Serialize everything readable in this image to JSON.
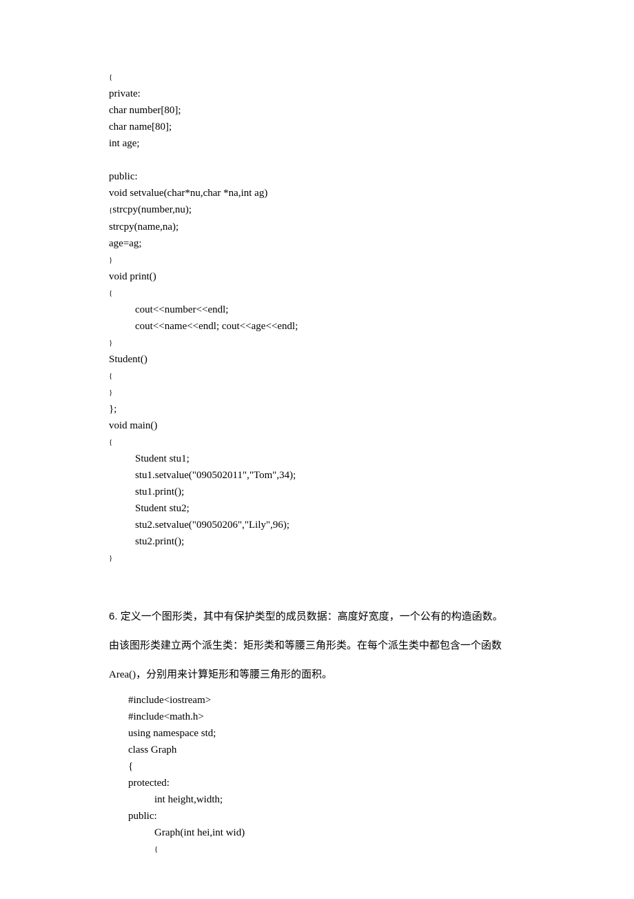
{
  "code1": {
    "lines": [
      {
        "text": "{",
        "cls": "small"
      },
      {
        "text": "private:",
        "cls": ""
      },
      {
        "text": "char number[80];",
        "cls": ""
      },
      {
        "text": "char name[80];",
        "cls": ""
      },
      {
        "text": "int age;",
        "cls": ""
      },
      {
        "text": "",
        "cls": ""
      },
      {
        "text": "public:",
        "cls": ""
      },
      {
        "text": "void setvalue(char*nu,char *na,int ag)",
        "cls": ""
      },
      {
        "text": "{strcpy(number,nu);",
        "cls": "mixed-open"
      },
      {
        "text": "strcpy(name,na);",
        "cls": ""
      },
      {
        "text": "age=ag;",
        "cls": ""
      },
      {
        "text": "}",
        "cls": "small"
      },
      {
        "text": "void print()",
        "cls": ""
      },
      {
        "text": "{",
        "cls": "small"
      },
      {
        "text": "cout<<number<<endl;",
        "cls": "indent1"
      },
      {
        "text": "cout<<name<<endl; cout<<age<<endl;",
        "cls": "indent1"
      },
      {
        "text": "}",
        "cls": "small"
      },
      {
        "text": "Student()",
        "cls": ""
      },
      {
        "text": "{",
        "cls": "small"
      },
      {
        "text": "}",
        "cls": "small"
      },
      {
        "text": "};",
        "cls": ""
      },
      {
        "text": "void main()",
        "cls": ""
      },
      {
        "text": "{",
        "cls": "small"
      },
      {
        "text": "Student stu1;",
        "cls": "indent1"
      },
      {
        "text": "stu1.setvalue(\"090502011\",\"Tom\",34);",
        "cls": "indent1"
      },
      {
        "text": "stu1.print();",
        "cls": "indent1"
      },
      {
        "text": "Student stu2;",
        "cls": "indent1"
      },
      {
        "text": "stu2.setvalue(\"09050206\",\"Lily\",96);",
        "cls": "indent1"
      },
      {
        "text": "stu2.print();",
        "cls": "indent1"
      },
      {
        "text": "}",
        "cls": "small"
      }
    ]
  },
  "problem": {
    "num": "6.",
    "line1": "定义一个图形类，其中有保护类型的成员数据：高度好宽度，一个公有的构造函数。",
    "line2": "由该图形类建立两个派生类：矩形类和等腰三角形类。在每个派生类中都包含一个函数",
    "line3": "Area()，分别用来计算矩形和等腰三角形的面积。"
  },
  "code2": {
    "lines": [
      {
        "text": "#include<iostream>",
        "cls": ""
      },
      {
        "text": "#include<math.h>",
        "cls": ""
      },
      {
        "text": "using namespace std;",
        "cls": ""
      },
      {
        "text": "class Graph",
        "cls": ""
      },
      {
        "text": "{",
        "cls": ""
      },
      {
        "text": "protected:",
        "cls": ""
      },
      {
        "text": "int height,width;",
        "cls": "indent1"
      },
      {
        "text": "public:",
        "cls": ""
      },
      {
        "text": "Graph(int hei,int wid)",
        "cls": "indent1"
      },
      {
        "text": "{",
        "cls": "indent1 small"
      }
    ]
  }
}
